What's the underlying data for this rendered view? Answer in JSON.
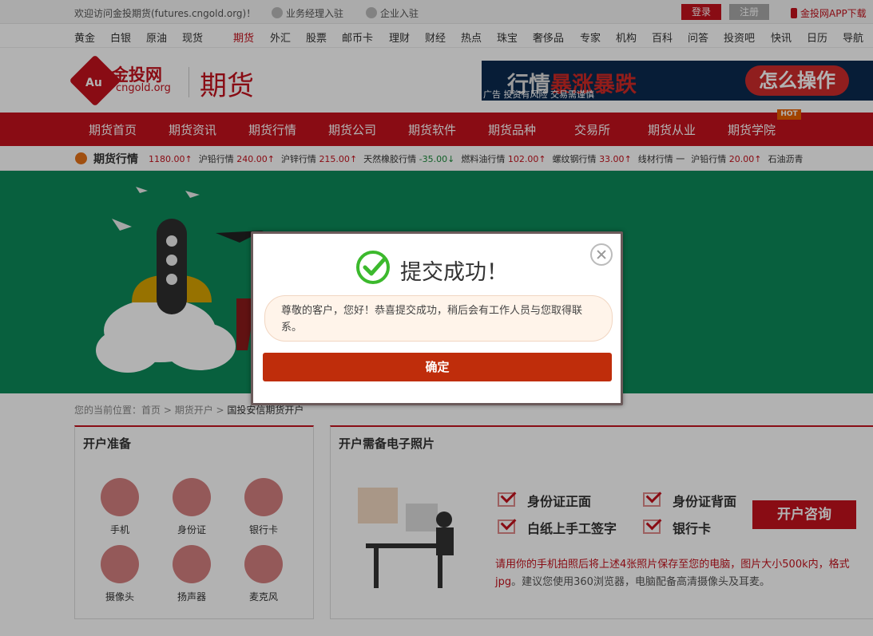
{
  "topbar": {
    "welcome": "欢迎访问金投期货(futures.cngold.org)！",
    "manager_link": "业务经理入驻",
    "company_link": "企业入驻",
    "login": "登录",
    "register": "注册",
    "app": "金投网APP下载"
  },
  "nav": [
    "黄金",
    "白银",
    "原油",
    "现货",
    "期货",
    "外汇",
    "股票",
    "邮币卡",
    "理财",
    "财经",
    "热点",
    "珠宝",
    "奢侈品",
    "专家",
    "机构",
    "百科",
    "问答",
    "投资吧",
    "快讯",
    "日历",
    "导航"
  ],
  "header": {
    "logo_badge": "Au",
    "logo_cn": "金投网",
    "logo_sub": "cngold.org",
    "section_title": "期货",
    "ad_prefix": "行情",
    "ad_highlight": "暴涨暴跌",
    "ad_button": "怎么操作",
    "ad_tag": "广告 投资有风险 交易需谨慎"
  },
  "main_nav": [
    "期货首页",
    "期货资讯",
    "期货行情",
    "期货公司",
    "期货软件",
    "期货品种",
    "交易所",
    "期货从业",
    "期货学院"
  ],
  "hot_badge": "HOT",
  "ticker": {
    "label": "期货行情",
    "items": [
      {
        "name": "",
        "value": "1180.00",
        "dir": "↑"
      },
      {
        "name": "沪铅行情",
        "value": "240.00",
        "dir": "↑"
      },
      {
        "name": "沪锌行情",
        "value": "215.00",
        "dir": "↑"
      },
      {
        "name": "天然橡胶行情",
        "value": "-35.00",
        "dir": "↓"
      },
      {
        "name": "燃料油行情",
        "value": "102.00",
        "dir": "↑"
      },
      {
        "name": "螺纹钢行情",
        "value": "33.00",
        "dir": "↑"
      },
      {
        "name": "线材行情",
        "value": "一",
        "dir": ""
      },
      {
        "name": "沪铅行情",
        "value": "20.00",
        "dir": "↑"
      },
      {
        "name": "石油沥青",
        "value": "",
        "dir": ""
      }
    ]
  },
  "breadcrumb": {
    "prefix": "您的当前位置：",
    "home": "首页",
    "level2": "期货开户",
    "current": "国投安信期货开户"
  },
  "prepare": {
    "title": "开户准备",
    "items": [
      "手机",
      "身份证",
      "银行卡",
      "摄像头",
      "扬声器",
      "麦克风"
    ]
  },
  "photos": {
    "title": "开户需备电子照片",
    "items": [
      "身份证正面",
      "身份证背面",
      "白纸上手工签字",
      "银行卡"
    ],
    "consult_button": "开户咨询",
    "note_red": "请用你的手机拍照后将上述4张照片保存至您的电脑，图片大小500k内，格式jpg",
    "note_rest": "。建议您使用360浏览器，电脑配备高清摄像头及耳麦。"
  },
  "modal": {
    "title": "提交成功！",
    "message": "尊敬的客户，您好！恭喜提交成功，稍后会有工作人员与您取得联系。",
    "confirm": "确定"
  },
  "colors": {
    "brand_red": "#c4121d",
    "banner_green": "#0c8a59",
    "confirm_button": "#bf2d0b",
    "success_green": "#3cb92d"
  }
}
